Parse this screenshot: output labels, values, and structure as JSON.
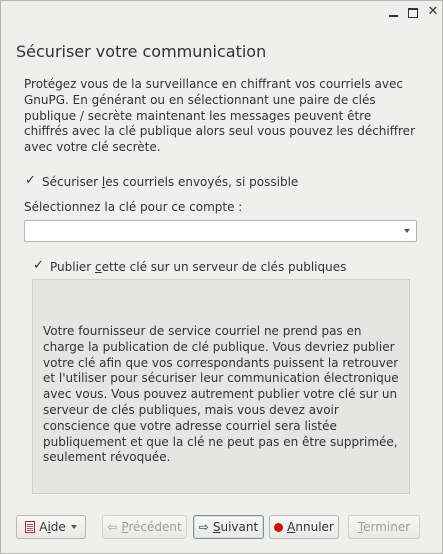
{
  "window": {
    "minimize_icon": "minimize-icon",
    "maximize_icon": "maximize-icon",
    "close_icon": "close-icon"
  },
  "heading": "Sécuriser votre communication",
  "description": "Protégez vous de la surveillance en chiffrant vos courriels avec GnuPG. En générant ou en sélectionnant une paire de clés publique / secrète maintenant les messages peuvent être chiffrés avec la clé publique alors seul vous pouvez les déchiffrer avec votre clé secrète.",
  "secure_checkbox": {
    "label_pre": "Sécuriser ",
    "label_mnemonic": "l",
    "label_post": "es courriels envoyés, si possible",
    "checked": true
  },
  "key_select": {
    "label": "Sélectionnez la clé pour ce compte :",
    "value": ""
  },
  "publish_checkbox": {
    "label_pre": "Publier ",
    "label_mnemonic": "c",
    "label_post": "ette clé sur un serveur de clés publiques",
    "checked": true
  },
  "info": "Votre fournisseur de service courriel ne prend pas en charge la publication de clé publique. Vous devriez publier votre clé afin que vos correspondants puissent la retrouver et l'utiliser pour sécuriser leur communication électronique avec vous. Vous pouvez autrement publier votre clé sur un serveur de clés publiques, mais vous devez avoir conscience que votre adresse courriel sera listée publiquement et que la clé ne peut pas en être supprimée, seulement révoquée.",
  "buttons": {
    "help": {
      "pre": "A",
      "mnemonic": "i",
      "post": "de",
      "icon": "help-book-icon"
    },
    "previous": {
      "pre": "",
      "mnemonic": "P",
      "post": "récédent",
      "icon": "arrow-left-icon"
    },
    "next": {
      "pre": "",
      "mnemonic": "S",
      "post": "uivant",
      "icon": "arrow-right-icon"
    },
    "cancel": {
      "pre": "",
      "mnemonic": "A",
      "post": "nnuler",
      "icon": "stop-icon"
    },
    "finish": {
      "pre": "",
      "mnemonic": "T",
      "post": "erminer"
    }
  }
}
